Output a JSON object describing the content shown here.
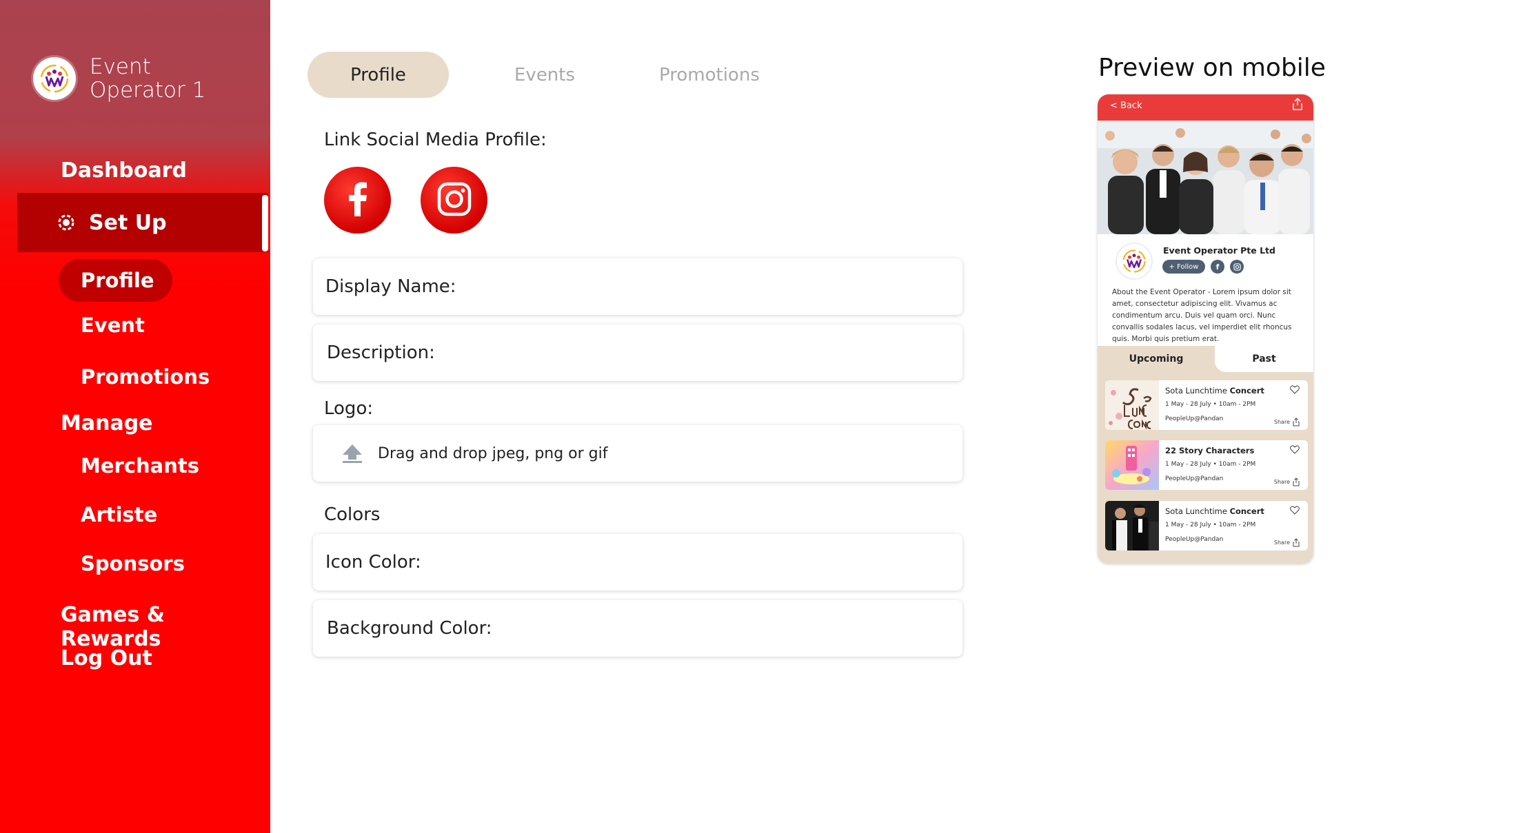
{
  "sidebar": {
    "brand_name": "Event\nOperator 1",
    "items": {
      "dashboard": "Dashboard",
      "setup": "Set Up",
      "profile": "Profile",
      "event": "Event",
      "promotions": "Promotions",
      "manage": "Manage",
      "merchants": "Merchants",
      "artiste": "Artiste",
      "sponsors": "Sponsors",
      "games": "Games & Rewards",
      "logout": "Log Out"
    }
  },
  "tabs": [
    "Profile",
    "Events",
    "Promotions"
  ],
  "form": {
    "social_label": "Link Social Media Profile:",
    "display_name": "Display Name:",
    "description": "Description:",
    "logo_label": "Logo:",
    "upload_text": "Drag and drop jpeg, png or gif",
    "colors_label": "Colors",
    "icon_color": "Icon Color:",
    "background_color": "Background Color:"
  },
  "preview": {
    "title": "Preview on mobile",
    "back": "< Back",
    "company": "Event Operator Pte Ltd",
    "follow": "+ Follow",
    "about": "About the Event Operator - Lorem ipsum dolor sit amet, consectetur adipiscing elit. Vivamus ac condimentum arcu. Duis vel quam orci. Nunc convallis sodales lacus, vel imperdiet elit rhoncus quis. Morbi quis pretium erat.",
    "tab_upcoming": "Upcoming",
    "tab_past": "Past",
    "events": [
      {
        "title_a": "Sota Lunchtime ",
        "title_b": "Concert",
        "date": "1 May - 28 July  •  10am - 2PM",
        "venue": "PeopleUp@Pandan",
        "share": "Share"
      },
      {
        "title_a": "22 Story Characters",
        "title_b": "",
        "date": "1 May - 28 July  •  10am - 2PM",
        "venue": "PeopleUp@Pandan",
        "share": "Share"
      },
      {
        "title_a": "Sota Lunchtime ",
        "title_b": "Concert",
        "date": "1 May - 28 July  •  10am - 2PM",
        "venue": "PeopleUp@Pandan",
        "share": "Share"
      }
    ]
  },
  "colors": {
    "sidebar_red": "#fe0000",
    "sidebar_top": "#a9434f",
    "active_dark": "#b30000",
    "tab_beige": "#e8dbca",
    "mobile_bar": "#ea3b3b"
  },
  "icons": [
    "brand-logo-icon",
    "setup-gear-icon",
    "facebook-icon",
    "instagram-icon",
    "upload-icon",
    "share-icon",
    "heart-icon"
  ]
}
